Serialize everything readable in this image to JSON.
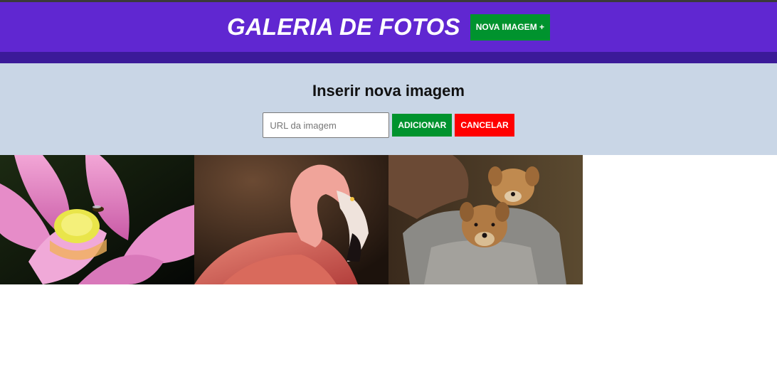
{
  "header": {
    "title": "GALERIA DE FOTOS",
    "new_image_label": "NOVA IMAGEM +"
  },
  "insert_panel": {
    "title": "Inserir nova imagem",
    "url_placeholder": "URL da imagem",
    "add_label": "ADICIONAR",
    "cancel_label": "CANCELAR"
  },
  "gallery": {
    "photos": [
      "lotus-flower-with-bee",
      "pink-flamingo",
      "puppies-in-hoodie-pocket"
    ]
  },
  "colors": {
    "header": "#6027d1",
    "header_band": "#3b1a99",
    "panel": "#c9d6e6",
    "success": "#00932e",
    "danger": "#ff0000"
  }
}
